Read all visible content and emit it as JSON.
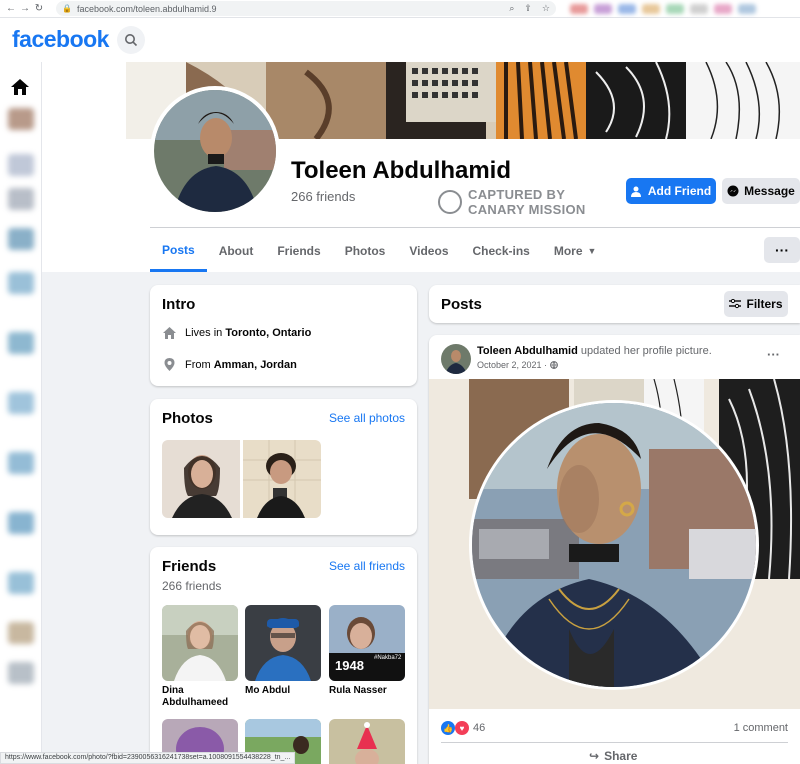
{
  "browser": {
    "url": "facebook.com/toleen.abdulhamid.9",
    "status_url": "https://www.facebook.com/photo/?fbid=2390056316241738set=a.1008091554438228_tn_..."
  },
  "header": {
    "logo": "facebook"
  },
  "profile": {
    "name": "Toleen Abdulhamid",
    "friends": "266 friends",
    "watermark_line1": "CAPTURED BY",
    "watermark_line2": "CANARY MISSION",
    "add_friend_label": "Add Friend",
    "message_label": "Message",
    "more_label": "···"
  },
  "tabs": [
    "Posts",
    "About",
    "Friends",
    "Photos",
    "Videos",
    "Check-ins",
    "More"
  ],
  "intro": {
    "title": "Intro",
    "lives_prefix": "Lives in",
    "lives_city": "Toronto, Ontario",
    "from_prefix": "From",
    "from_city": "Amman, Jordan"
  },
  "photos": {
    "title": "Photos",
    "see_all": "See all photos"
  },
  "friends": {
    "title": "Friends",
    "count": "266 friends",
    "see_all": "See all friends",
    "list": [
      {
        "name": "Dina Abdulhameed"
      },
      {
        "name": "Mo Abdul"
      },
      {
        "name": "Rula Nasser"
      }
    ],
    "rula_badge_num": "1948",
    "rula_badge_tag": "#Nakba72"
  },
  "posts_header": {
    "title": "Posts",
    "filters_label": "Filters"
  },
  "post": {
    "author": "Toleen Abdulhamid",
    "action": "updated her profile picture.",
    "date": "October 2, 2021 ·",
    "reactions_count": "46",
    "comments": "1 comment",
    "share_label": "Share",
    "menu": "···"
  },
  "colors": {
    "brand": "#1877f2",
    "bg": "#f0f2f5",
    "text_secondary": "#65676b"
  }
}
